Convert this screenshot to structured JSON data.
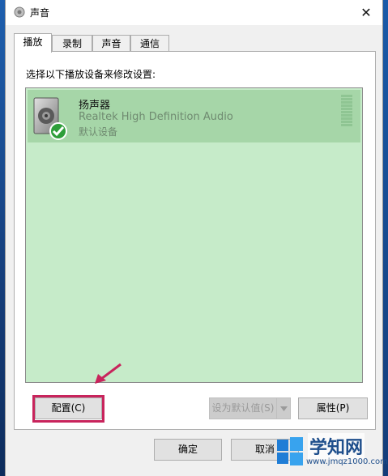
{
  "window": {
    "title": "声音"
  },
  "tabs": [
    {
      "label": "播放"
    },
    {
      "label": "录制"
    },
    {
      "label": "声音"
    },
    {
      "label": "通信"
    }
  ],
  "panel": {
    "instruction": "选择以下播放设备来修改设置:",
    "devices": [
      {
        "name": "扬声器",
        "driver": "Realtek High Definition Audio",
        "status": "默认设备",
        "icon": "speaker-icon",
        "badge": "checkmark-icon"
      }
    ]
  },
  "buttons": {
    "configure": "配置(C)",
    "set_default": "设为默认值(S)",
    "properties": "属性(P)",
    "ok": "确定",
    "cancel": "取消"
  },
  "watermark": {
    "text": "学知网",
    "url": "www.jmqz1000.com"
  },
  "colors": {
    "list_bg": "#c6ebc9",
    "selected_bg": "#a6d6a8",
    "highlight": "#c8245c",
    "check": "#2e9e3a"
  }
}
